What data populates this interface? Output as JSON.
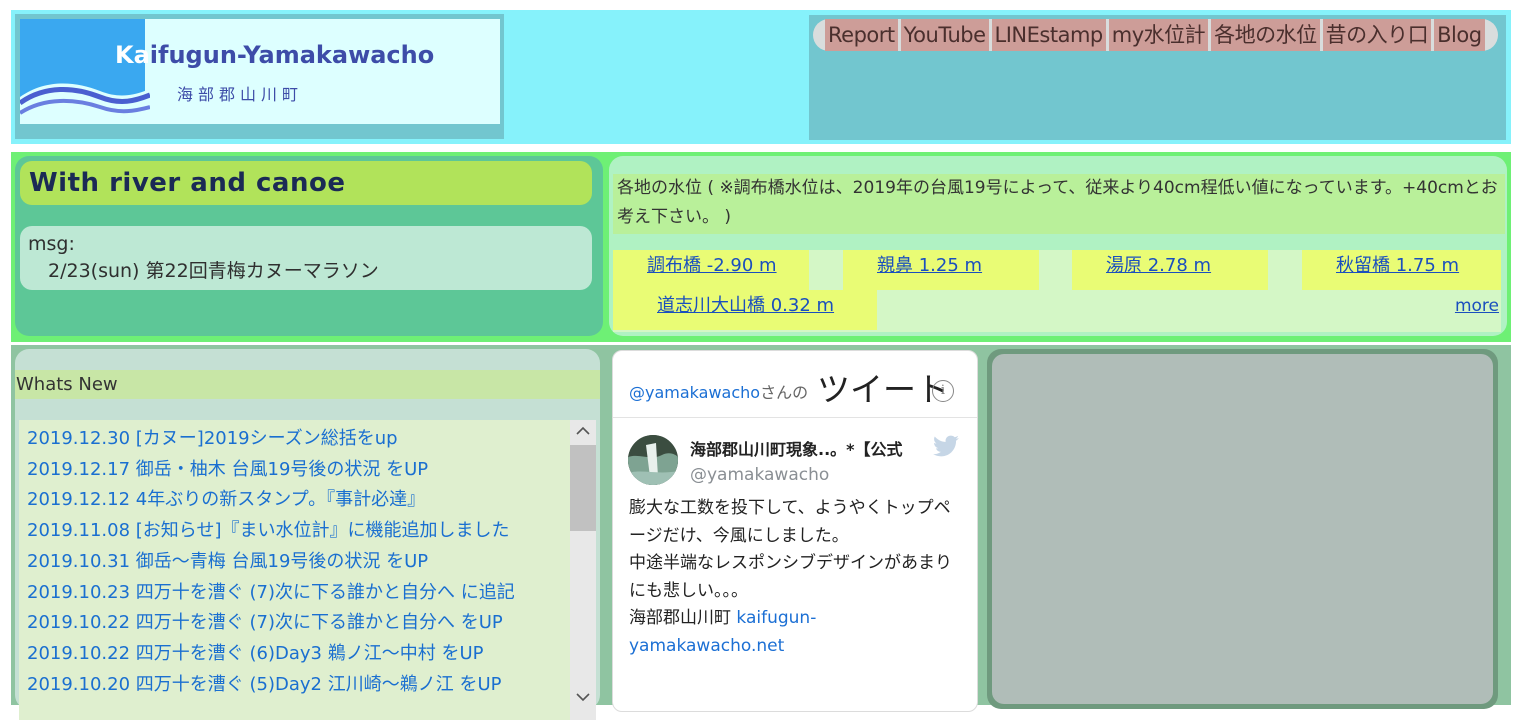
{
  "header": {
    "logo": {
      "title_first": "Ka",
      "title_rest": "ifugun-Yamakawacho",
      "subtitle": "海部郡山川町"
    },
    "nav": [
      "Report",
      "YouTube",
      "LINEstamp",
      "my水位計",
      "各地の水位",
      "昔の入り口",
      "Blog"
    ]
  },
  "canoe": {
    "title": "With river and canoe",
    "msg_label": "msg:",
    "msg_text": "2/23(sun) 第22回青梅カヌーマラソン"
  },
  "water": {
    "description": "各地の水位 ( ※調布橋水位は、2019年の台風19号によって、従来より40cm程低い値になっています。+40cmとお考え下さい。 )",
    "stations": [
      "調布橋  -2.90 m",
      "親鼻  1.25 m",
      "湯原  2.78 m",
      "秋留橋  1.75 m",
      "道志川大山橋  0.32 m"
    ],
    "more": "more"
  },
  "news": {
    "heading": "Whats New",
    "items": [
      "2019.12.30 [カヌー]2019シーズン総括をup",
      "2019.12.17 御岳・柚木 台風19号後の状況 をUP",
      "2019.12.12 4年ぶりの新スタンプ。『事計必達』",
      "2019.11.08 [お知らせ]『まい水位計』に機能追加しました",
      "2019.10.31 御岳〜青梅 台風19号後の状況 をUP",
      "2019.10.23 四万十を漕ぐ (7)次に下る誰かと自分へ に追記",
      "2019.10.22 四万十を漕ぐ (7)次に下る誰かと自分へ をUP",
      "2019.10.22 四万十を漕ぐ (6)Day3 鵜ノ江〜中村 をUP",
      "2019.10.20 四万十を漕ぐ (5)Day2 江川崎〜鵜ノ江 をUP"
    ]
  },
  "twitter": {
    "handle_link": "@yamakawacho",
    "handle_suffix": "さんの",
    "title": "ツイート",
    "info_icon": "i",
    "account_name": "海部郡山川町現象..。*【公式",
    "account_handle": "@yamakawacho",
    "body_lines": [
      "膨大な工数を投下して、ようやくトップページだけ、今風にしました。",
      "中途半端なレスポンシブデザインがあまりにも悲しい。。。"
    ],
    "signature_prefix": "海部郡山川町 ",
    "signature_link": "kaifugun-yamakawacho.net"
  },
  "colors": {
    "header_bg": "#86f2fb",
    "nav_item": "#cd9d98",
    "row2_bg": "#6ef075",
    "canoe_title": "#b1e35a",
    "station_bg": "#e9fc75",
    "link": "#1a4fbe"
  }
}
